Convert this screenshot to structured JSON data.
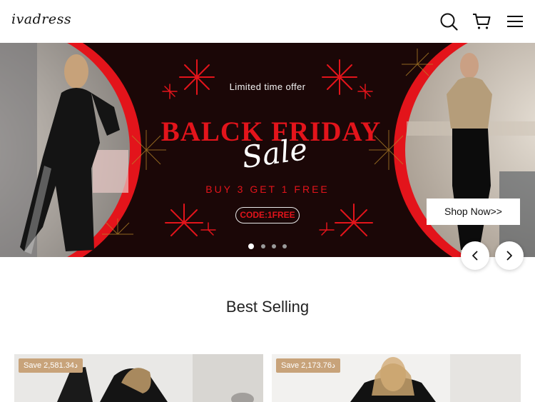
{
  "header": {
    "logo": "ivadress",
    "icons": [
      "search-icon",
      "cart-icon",
      "menu-icon"
    ]
  },
  "banner": {
    "limited": "Limited time offer",
    "title": "BALCK FRIDAY",
    "script": "Sale",
    "subtitle": "BUY 3 GET 1 FREE",
    "code": "CODE:1FREE",
    "shop_now": "Shop Now>>",
    "slide_count": 4,
    "active_slide": 1,
    "colors": {
      "background": "#1b0707",
      "accent": "#e3141b"
    }
  },
  "best_selling": {
    "title": "Best Selling",
    "products": [
      {
        "badge": "Save 2,581.34د"
      },
      {
        "badge": "Save 2,173.76د"
      }
    ]
  }
}
